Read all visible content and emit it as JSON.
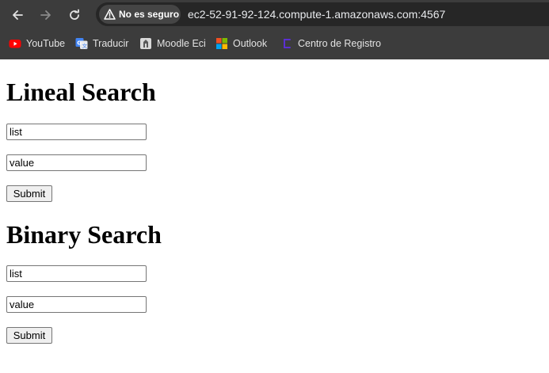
{
  "browser": {
    "security_label": "No es seguro",
    "url": "ec2-52-91-92-124.compute-1.amazonaws.com:4567",
    "bookmarks": [
      {
        "label": "YouTube",
        "icon": "youtube-icon"
      },
      {
        "label": "Traducir",
        "icon": "translate-icon"
      },
      {
        "label": "Moodle Eci",
        "icon": "moodle-icon"
      },
      {
        "label": "Outlook",
        "icon": "outlook-icon"
      },
      {
        "label": "Centro de Registro",
        "icon": "registro-icon"
      }
    ]
  },
  "lineal": {
    "title": "Lineal Search",
    "list_value": "list",
    "value_value": "value",
    "submit_label": "Submit"
  },
  "binary": {
    "title": "Binary Search",
    "list_value": "list",
    "value_value": "value",
    "submit_label": "Submit"
  }
}
